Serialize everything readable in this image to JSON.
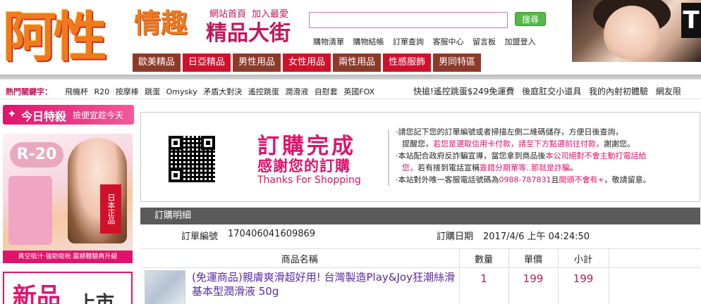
{
  "header": {
    "logo_main": "阿性",
    "logo_sub": "情趣",
    "logo_sub2": "精品大街",
    "top_links": [
      "網站首頁",
      "加入最愛"
    ],
    "search_placeholder": "",
    "search_button": "搜尋",
    "member_links": [
      "購物清單",
      "購物結帳",
      "訂單查詢",
      "客服中心",
      "留言板",
      "加盟登入"
    ],
    "categories": [
      {
        "label": "歐美精品",
        "style": "brown"
      },
      {
        "label": "日亞精品",
        "style": "red"
      },
      {
        "label": "男性用品",
        "style": "brown"
      },
      {
        "label": "女性用品",
        "style": "red"
      },
      {
        "label": "兩性用品",
        "style": "brown"
      },
      {
        "label": "性感服飾",
        "style": "red"
      },
      {
        "label": "男同特區",
        "style": "brown"
      }
    ],
    "banner_letter": "T"
  },
  "hot": {
    "title": "熱門關鍵字：",
    "words": [
      "飛機杯",
      "R20",
      "按摩棒",
      "跳蛋",
      "Omysky",
      "矛盾大對決",
      "遙控跳蛋",
      "潤滑液",
      "自慰套",
      "英國FOX"
    ],
    "marquee": [
      "快搶!遙控跳蛋$249免運費",
      "後庭肛交小道具",
      "我的內射初體驗",
      "網友限"
    ]
  },
  "sidebar": {
    "today_title": "今日特殺",
    "today_sub": "撿便宜趁今天",
    "promo_r20": "R-20",
    "promo_tag": "日本正品",
    "promo_foot": "真空吸汁‧強勁吸吮‧震撼體驗再升級",
    "new_title": "新品",
    "new_sub": "上市"
  },
  "thanks": {
    "title": "訂購完成",
    "subtitle": "感謝您的訂購",
    "english": "Thanks For Shopping",
    "notes": [
      {
        "prefix": "‧請您記下您的訂單編號或者掃描左側二維碼儲存，方便日後查詢，"
      },
      {
        "prefix": "提醒您，",
        "pink": "若您是選取信用卡付款，請至下方點選前往付款，",
        "suffix": "謝謝您。"
      },
      {
        "prefix": "‧本站配合政府反詐騙宣導，當您拿到商品後",
        "pink": "本公司絕對不會主動打電話給",
        "suffix": ""
      },
      {
        "prefix": "",
        "pink": "您，",
        "suffix": "若有接到電話宣稱",
        "pink2": "簽錯分期單等..那就是詐騙",
        "suffix2": "。"
      },
      {
        "prefix": "‧本站對外唯一客服電話號碼為",
        "pink": "0988-787831",
        "suffix": "且",
        "pink2": "開頭不會有+",
        "suffix2": "，敬請留意。"
      }
    ]
  },
  "order": {
    "section_title": "訂購明細",
    "number_label": "訂單編號",
    "number_value": "170406041609869",
    "date_label": "訂購日期",
    "date_value": "2017/4/6  上午  04:24:50",
    "columns": [
      "商品名稱",
      "數量",
      "單價",
      "小計"
    ],
    "items": [
      {
        "name": "(免運商品)親膚爽滑超好用! 台灣製造Play&Joy狂潮絲滑基本型潤滑液 50g",
        "qty": "1",
        "price": "199",
        "subtotal": "199"
      }
    ]
  },
  "colors": {
    "pink": "#e0136c",
    "brown_tab": "#8d3a2b",
    "red_tab": "#d0112b",
    "green_button": "#56b846",
    "dark_header": "#5a5a5a"
  }
}
